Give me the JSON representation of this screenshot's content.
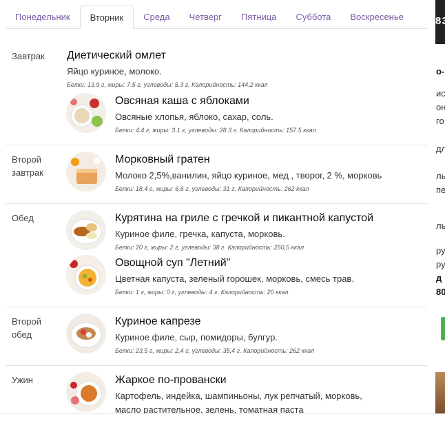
{
  "tabs": [
    {
      "label": "Понедельник",
      "active": false
    },
    {
      "label": "Вторник",
      "active": true
    },
    {
      "label": "Среда",
      "active": false
    },
    {
      "label": "Четверг",
      "active": false
    },
    {
      "label": "Пятница",
      "active": false
    },
    {
      "label": "Суббота",
      "active": false
    },
    {
      "label": "Воскресенье",
      "active": false
    }
  ],
  "meals": {
    "breakfast": {
      "label": "Завтрак",
      "dishes": [
        {
          "name": "Диетический омлет",
          "ingredients": "Яйцо куриное, молоко.",
          "nutrition": "Белки: 13.9 г, жиры: 7.5 г, углеводы: 5.3 г. Калорийность: 144.2 ккал"
        },
        {
          "name": "Овсяная каша с яблоками",
          "ingredients": "Овсяные хлопья, яблоко, сахар, соль.",
          "nutrition": "Белки: 4.4 г, жиры: 3.1 г, углеводы: 28.3 г. Калорийность: 157.5 ккал"
        }
      ]
    },
    "second_breakfast": {
      "label": "Второй завтрак",
      "dishes": [
        {
          "name": "Морковный гратен",
          "ingredients": "Молоко 2,5%,ванилин, яйцо куриное, мед , творог, 2 %, морковь",
          "nutrition": "Белки: 18,4 г, жиры: 6,6 г, углеводы: 31 г. Калорийность: 262 ккал"
        }
      ]
    },
    "lunch": {
      "label": "Обед",
      "dishes": [
        {
          "name": "Курятина на гриле с гречкой и пикантной капустой",
          "ingredients": "Куриное филе, гречка, капуста, морковь.",
          "nutrition": "Белки: 20 г, жиры: 2 г, углеводы: 38 г. Калорийность: 250,5 ккал"
        },
        {
          "name": "Овощной суп \"Летний\"",
          "ingredients": "Цветная капуста, зеленый горошек, морковь, смесь трав.",
          "nutrition": "Белки: 1 г, жиры: 0 г, углеводы: 4 г. Калорийность: 20 ккал"
        }
      ]
    },
    "second_lunch": {
      "label": "Второй обед",
      "dishes": [
        {
          "name": "Куриное капрезе",
          "ingredients": "Куриное филе, сыр, помидоры, булгур.",
          "nutrition": "Белки: 23,5 г, жиры: 2,4 г, углеводы: 35,4 г. Калорийность: 262 ккал"
        }
      ]
    },
    "dinner": {
      "label": "Ужин",
      "dishes": [
        {
          "name": "Жаркое по-провански",
          "ingredients": "Картофель, индейка, шампиньоны, лук репчатый, морковь, масло растительное, зелень, томатная паста"
        }
      ]
    }
  },
  "side_page": {
    "header_text": "83",
    "snippets": [
      "о-,",
      "ис",
      "он",
      "го",
      "дл",
      "ль",
      "пе",
      "ль",
      "ру",
      "ру",
      "д",
      "80"
    ]
  }
}
